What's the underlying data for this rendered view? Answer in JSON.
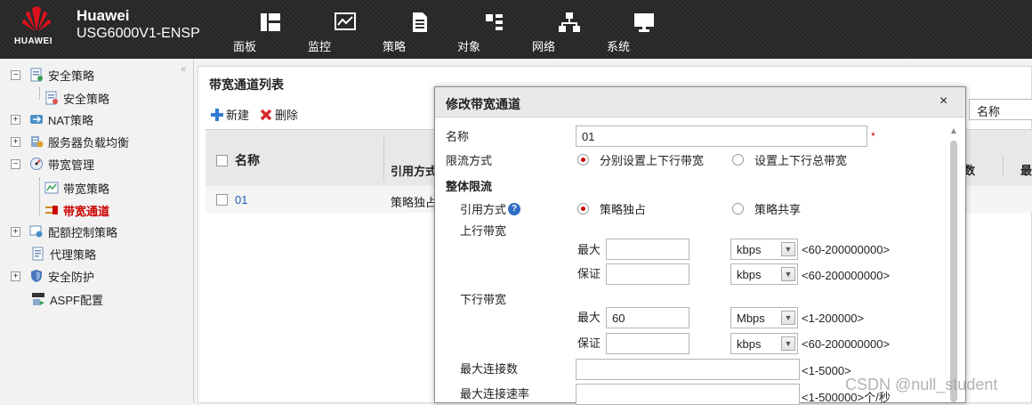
{
  "header": {
    "brand_small": "HUAWEI",
    "brand_name": "Huawei",
    "device_model": "USG6000V1-ENSP",
    "nav": [
      "面板",
      "监控",
      "策略",
      "对象",
      "网络",
      "系统"
    ]
  },
  "sidebar": {
    "items": [
      {
        "label": "安全策略",
        "expander": "−"
      },
      {
        "label": "安全策略"
      },
      {
        "label": "NAT策略",
        "expander": "+"
      },
      {
        "label": "服务器负载均衡",
        "expander": "+"
      },
      {
        "label": "带宽管理",
        "expander": "−"
      },
      {
        "label": "带宽策略"
      },
      {
        "label": "带宽通道"
      },
      {
        "label": "配额控制策略",
        "expander": "+"
      },
      {
        "label": "代理策略"
      },
      {
        "label": "安全防护",
        "expander": "+"
      },
      {
        "label": "ASPF配置"
      }
    ],
    "collapse_glyph": "«"
  },
  "main": {
    "title": "带宽通道列表",
    "toolbar": {
      "new_label": "新建",
      "delete_label": "删除"
    },
    "search_label": "名称",
    "columns": {
      "name": "名称",
      "ref": "引用方式",
      "col_right1": "数",
      "col_right2": "最"
    },
    "rows": [
      {
        "name": "01",
        "ref": "策略独占"
      }
    ]
  },
  "modal": {
    "title": "修改带宽通道",
    "close": "×",
    "name_label": "名称",
    "name_value": "01",
    "required_mark": "*",
    "limit_mode_label": "限流方式",
    "limit_mode_opt1": "分别设置上下行带宽",
    "limit_mode_opt2": "设置上下行总带宽",
    "overall_section": "整体限流",
    "ref_mode_label": "引用方式",
    "ref_mode_help": "?",
    "ref_opt1": "策略独占",
    "ref_opt2": "策略共享",
    "up_label": "上行带宽",
    "down_label": "下行带宽",
    "max_label": "最大",
    "guarantee_label": "保证",
    "up_max_value": "",
    "up_max_unit": "kbps",
    "up_max_range": "<60-200000000>",
    "up_guar_value": "",
    "up_guar_unit": "kbps",
    "up_guar_range": "<60-200000000>",
    "down_max_value": "60",
    "down_max_unit": "Mbps",
    "down_max_range": "<1-200000>",
    "down_guar_value": "",
    "down_guar_unit": "kbps",
    "down_guar_range": "<60-200000000>",
    "max_conn_label": "最大连接数",
    "max_conn_range": "<1-5000>",
    "max_rate_label": "最大连接速率",
    "max_rate_range": "<1-500000>个/秒"
  },
  "watermark": "CSDN @null_student"
}
